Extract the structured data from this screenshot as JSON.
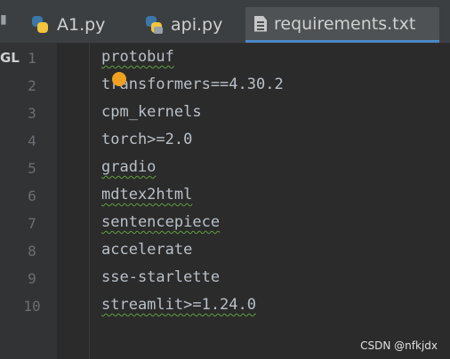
{
  "tabs": [
    {
      "label": "A1.py",
      "icon": "python-file-icon",
      "active": false
    },
    {
      "label": "api.py",
      "icon": "python-file-icon",
      "active": false
    },
    {
      "label": "requirements.txt",
      "icon": "text-file-icon",
      "active": true,
      "close": "×"
    }
  ],
  "side_panel_label": "GL",
  "editor": {
    "lines": [
      {
        "no": "1",
        "text": "protobuf"
      },
      {
        "no": "2",
        "text": "transformers==4.30.2"
      },
      {
        "no": "3",
        "text": "cpm_kernels"
      },
      {
        "no": "4",
        "text": "torch>=2.0"
      },
      {
        "no": "5",
        "text": "gradio"
      },
      {
        "no": "6",
        "text": "mdtex2html"
      },
      {
        "no": "7",
        "text": "sentencepiece"
      },
      {
        "no": "8",
        "text": "accelerate"
      },
      {
        "no": "9",
        "text": "sse-starlette"
      },
      {
        "no": "10",
        "text": "streamlit>=1.24.0"
      }
    ]
  },
  "watermark": "CSDN @nfkjdx",
  "colors": {
    "background": "#2b2b2b",
    "tab_active": "#4e5254",
    "accent": "#4a88c7",
    "bulb": "#f0a020"
  }
}
